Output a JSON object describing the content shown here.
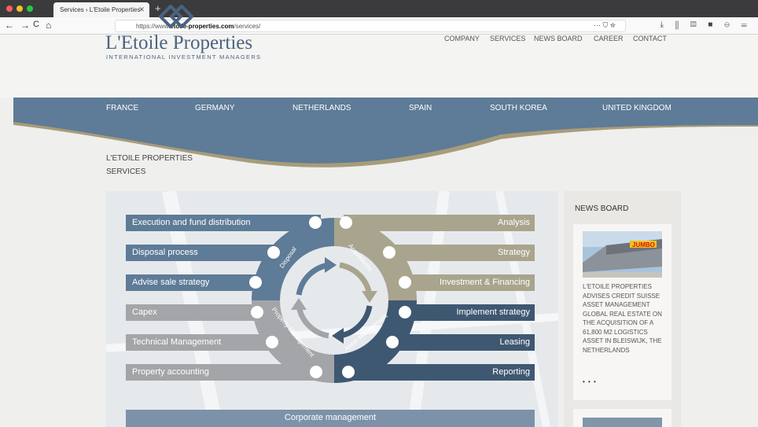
{
  "browser": {
    "tab_title": "Services › L'Etoile Properties",
    "tab_close": "✕",
    "new_tab": "+",
    "url_prefix": "https://www.",
    "url_domain": "etoile-properties.com",
    "url_path": "/services/",
    "url_icons": "··· ⛉ ☆",
    "toolbar_icons": "⤓ ⫼ ▤ ■ ⊖ ☰",
    "nav": {
      "back": "←",
      "forward": "→",
      "reload": "C",
      "home": "⌂"
    }
  },
  "site": {
    "logo_title": "L'Etoile Properties",
    "logo_subtitle": "INTERNATIONAL INVESTMENT MANAGERS",
    "top_nav": [
      "COMPANY",
      "SERVICES",
      "NEWS BOARD",
      "CAREER",
      "CONTACT"
    ],
    "countries": [
      "FRANCE",
      "GERMANY",
      "NETHERLANDS",
      "SPAIN",
      "SOUTH KOREA",
      "UNITED KINGDOM"
    ]
  },
  "breadcrumb": {
    "line1": "L'ETOILE PROPERTIES",
    "line2": "SERVICES"
  },
  "diagram": {
    "left_items": [
      "Execution and fund distribution",
      "Disposal process",
      "Advise sale strategy",
      "Capex",
      "Technical Management",
      "Property accounting"
    ],
    "right_items": [
      "Analysis",
      "Strategy",
      "Investment & Financing",
      "Implement strategy",
      "Leasing",
      "Reporting"
    ],
    "ring_labels": {
      "disposal": "Disposal",
      "acquisitions": "Acquisitions",
      "property": "Property Management",
      "asset": "Asset Management"
    },
    "footer": "Corporate management",
    "colors": {
      "blue": "#5e7b97",
      "grey": "#a3a5a8",
      "tan": "#a9a48d",
      "navy": "#3f5871"
    }
  },
  "news_board": {
    "title": "NEWS BOARD",
    "article_text": "L'ETOILE PROPERTIES ADVISES CREDIT SUISSE ASSET MANAGEMENT GLOBAL REAL ESTATE ON THE ACQUISITION OF A 61,800 M2 LOGISTICS ASSET IN BLEISWIJK, THE NETHERLANDS",
    "more": "• • •",
    "image_sign": "JUMBO"
  }
}
